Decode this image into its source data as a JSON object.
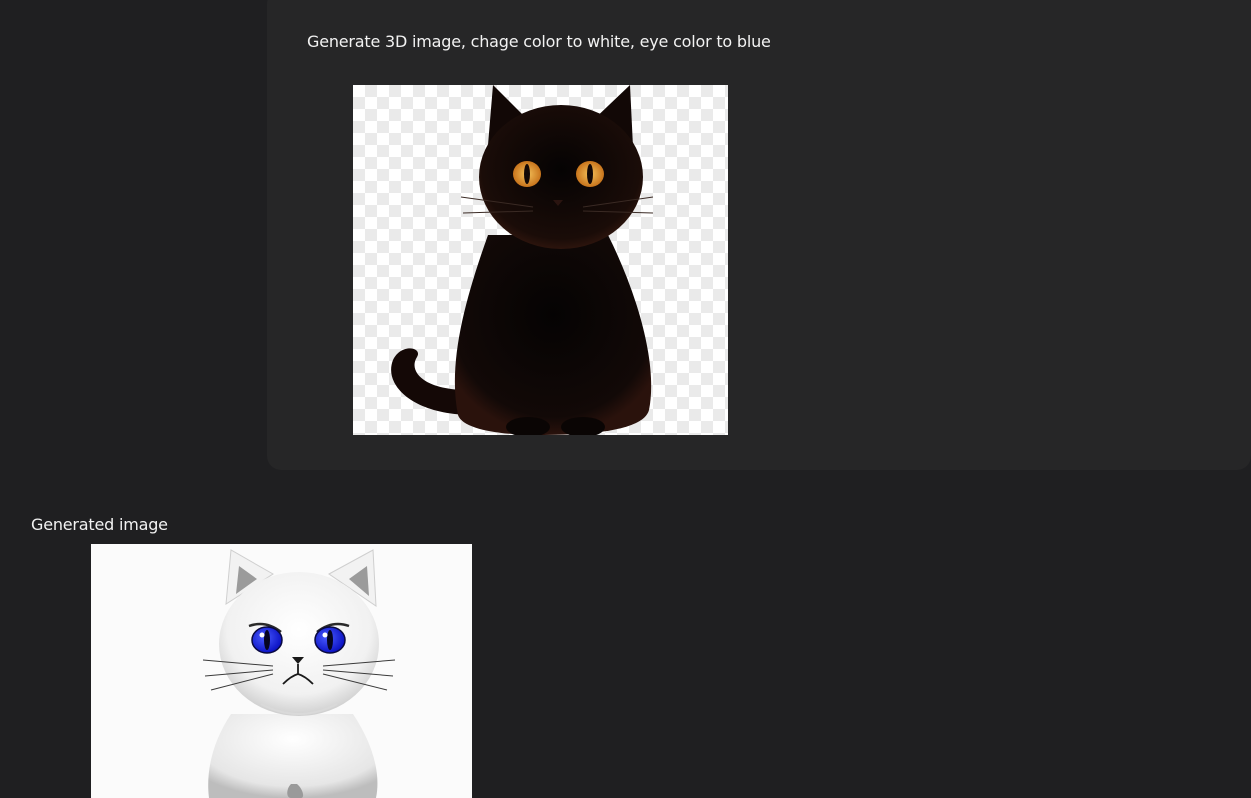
{
  "message": {
    "prompt": "Generate 3D image, chage color to white, eye color to blue",
    "attachment": {
      "subject": "black-cat",
      "eye_color": "#e39a2b",
      "fur_color": "#0b0706"
    }
  },
  "response": {
    "label": "Generated image",
    "image": {
      "subject": "white-cat",
      "eye_color": "#1a22d9",
      "fur_color": "#f3f3f3"
    }
  },
  "colors": {
    "background": "#1f1f21",
    "bubble": "#262627",
    "text": "#f2f2f2"
  }
}
